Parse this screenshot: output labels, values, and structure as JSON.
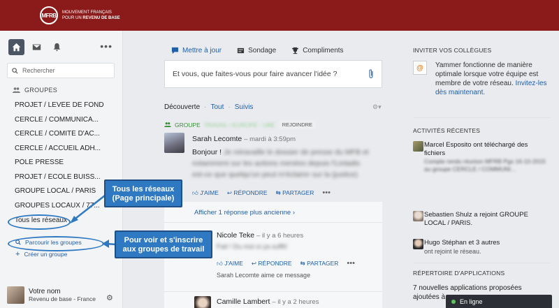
{
  "header": {
    "logo_mark": "MFRB",
    "logo_line1": "MOUVEMENT FRANÇAIS",
    "logo_line2_prefix": "POUR UN",
    "logo_line2_bold": "REVENU DE BASE"
  },
  "sidebar": {
    "search_placeholder": "Rechercher",
    "groups_title": "GROUPES",
    "groups": [
      "PROJET / LEVÉE DE FOND",
      "CERCLE / COMMUNICA...",
      "CERCLE / COMITÉ D'AC...",
      "CERCLE / ACCUEIL ADH...",
      "PÔLE PRESSE",
      "PROJET / ÉCOLE BUISS...",
      "GROUPE LOCAL / PARIS",
      "GROUPES LOCAUX / 77..."
    ],
    "all_networks": "Tous les réseaux",
    "browse_groups": "Parcourir les groupes",
    "create_group": "Créer un groupe",
    "profile_name": "Votre nom",
    "profile_sub": "Revenu de base - France"
  },
  "callouts": {
    "networks_line1": "Tous les réseaux",
    "networks_line2": "(Page principale)",
    "groups_line1": "Pour voir et s'inscrire",
    "groups_line2": "aux groupes de travail"
  },
  "composer": {
    "tab_update": "Mettre à jour",
    "tab_poll": "Sondage",
    "tab_praise": "Compliments",
    "placeholder": "Et vous, que faites-vous pour faire avancer l'idée ?"
  },
  "feed": {
    "filter_discover": "Découverte",
    "filter_all": "Tout",
    "filter_following": "Suivis",
    "group_prefix": "GROUPE",
    "group_name": "TRAVAIL / EUROPE - UBE",
    "join_label": "REJOINDRE",
    "post1": {
      "author": "Sarah Lecomte",
      "meta": "– mardi à 3:59pm",
      "text_visible": "Bonjour !",
      "text_blur1": "Je retravaille le dossier de presse du MFB et",
      "text_blur2": "notamment sur les actions menées depuis l'Lintadis",
      "text_blur3": "est-ce que quelqu'un peut m'éclairer sur la (justice)",
      "like": "J'AIME",
      "reply": "RÉPONDRE",
      "share": "PARTAGER"
    },
    "older_replies": "Afficher 1 réponse plus ancienne ›",
    "reply1": {
      "author": "Nicole Teke",
      "meta": "– il y a 6 heures",
      "text_blur": "Fait ! Du moi si ça suffit!",
      "like": "J'AIME",
      "reply": "RÉPONDRE",
      "share": "PARTAGER",
      "liked_by": "Sarah Lecomte aime ce message"
    },
    "reply2": {
      "author": "Camille Lambert",
      "meta": "– il y a 2 heures"
    }
  },
  "right": {
    "invite_title": "INVITER VOS COLLÈGUES",
    "invite_text": "Yammer fonctionne de manière optimale lorsque votre équipe est membre de votre réseau.",
    "invite_link": "Invitez-les dès maintenant.",
    "activity_title": "ACTIVITÉS RÉCENTES",
    "activity1_text": "Marcel Esposito ont téléchargé des fichiers",
    "activity1_blur": "Compte rendu réunion MFRB Pgs 16-10-2015 au groupe CERCLE / COMMUNI...",
    "activity2_text": "Sebastien Shulz a rejoint GROUPE LOCAL / PARIS.",
    "activity3_text": "Hugo Stéphan et 3 autres",
    "activity3_rest": "ont rejoint le réseau.",
    "apps_title": "RÉPERTOIRE D'APPLICATIONS",
    "apps_text1": "7 nouvelles applications proposées",
    "apps_text2": "ajoutées à",
    "online": "En ligne"
  },
  "colors": {
    "topbar": "#8b1a1a",
    "link": "#1f5fa8",
    "callout": "#2f79c2",
    "group_green": "#3a8f3a"
  }
}
